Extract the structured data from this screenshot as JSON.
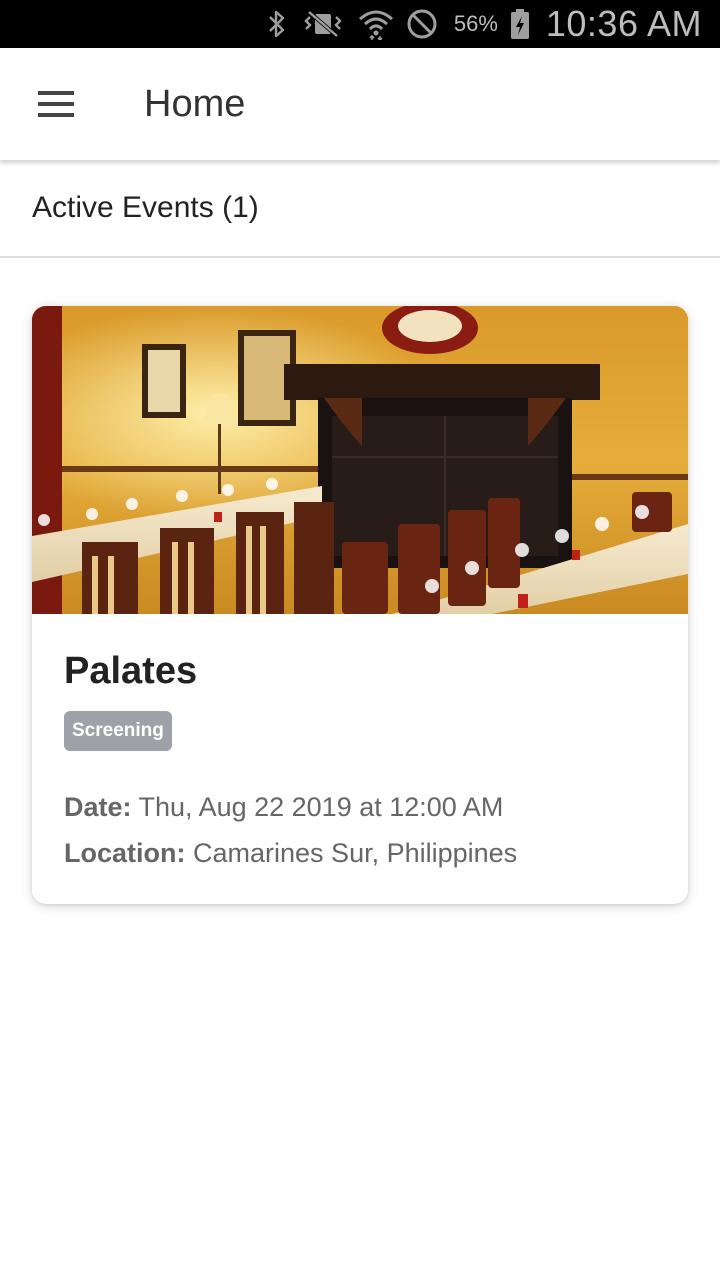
{
  "status_bar": {
    "battery_percent": "56%",
    "time": "10:36 AM",
    "icons": [
      "bluetooth-icon",
      "vibrate-icon",
      "wifi-icon",
      "do-not-disturb-icon",
      "battery-charging-icon"
    ]
  },
  "app_bar": {
    "title": "Home",
    "menu_icon": "hamburger-menu-icon"
  },
  "section": {
    "title": "Active Events (1)"
  },
  "events": [
    {
      "name": "Palates",
      "badge": "Screening",
      "date_label": "Date:",
      "date_value": "Thu, Aug 22 2019 at 12:00 AM",
      "location_label": "Location:",
      "location_value": "Camarines Sur, Philippines"
    }
  ],
  "colors": {
    "status_bar_bg": "#000000",
    "badge_bg": "#9ea2a8",
    "title_text": "#333333",
    "detail_text": "#666666"
  }
}
